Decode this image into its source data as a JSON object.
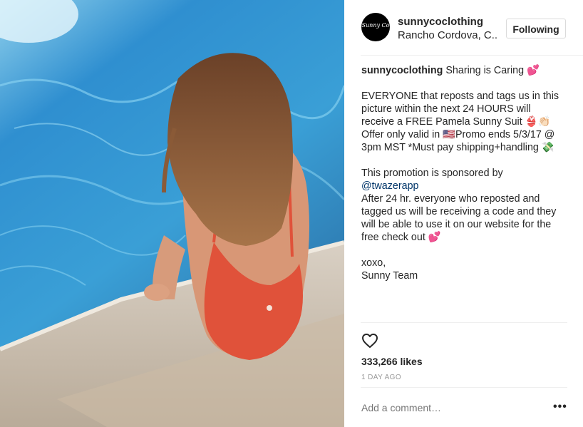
{
  "header": {
    "username": "sunnycoclothing",
    "location": "Rancho Cordova, C..",
    "follow_label": "Following",
    "avatar_text": "Sunny Co"
  },
  "caption": {
    "username": "sunnycoclothing",
    "line1": "Sharing is Caring 💕",
    "p1_l1": "EVERYONE that reposts and tags us in this",
    "p1_l2": "picture within the next 24 HOURS will",
    "p1_l3": "receive a FREE Pamela Sunny Suit 👙👏🏻",
    "p1_l4": "Offer only valid in 🇺🇸Promo ends 5/3/17 @",
    "p1_l5": "3pm MST *Must pay shipping+handling 💸",
    "p2_l1": "This promotion is sponsored by",
    "p2_mention": "@twazerapp",
    "p2_l3": "After 24 hr. everyone who reposted and",
    "p2_l4": "tagged us will be receiving a code and they",
    "p2_l5": "will be able to use it on our website for the",
    "p2_l6": "free check out 💕",
    "sign1": "xoxo,",
    "sign2": "Sunny Team"
  },
  "likes": "333,266 likes",
  "timestamp": "1 DAY AGO",
  "comment": {
    "placeholder": "Add a comment…",
    "more": "•••"
  },
  "icons": {
    "heart": "heart-icon",
    "more": "more-options-icon"
  }
}
